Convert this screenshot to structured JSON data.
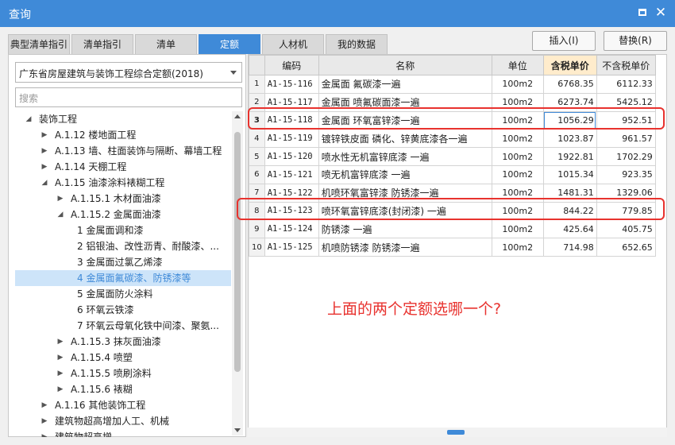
{
  "window": {
    "title": "查询"
  },
  "tabs": [
    "典型清单指引",
    "清单指引",
    "清单",
    "定额",
    "人材机",
    "我的数据"
  ],
  "actions": {
    "insert_label": "插入(I)",
    "replace_label": "替换(R)"
  },
  "left": {
    "quota_library": "广东省房屋建筑与装饰工程综合定额(2018)",
    "search_placeholder": "搜索",
    "tree": [
      {
        "label": "装饰工程",
        "level": 0,
        "toggle": "expanded"
      },
      {
        "label": "A.1.12 楼地面工程",
        "level": 1,
        "toggle": "collapsed"
      },
      {
        "label": "A.1.13 墙、柱面装饰与隔断、幕墙工程",
        "level": 1,
        "toggle": "collapsed"
      },
      {
        "label": "A.1.14 天棚工程",
        "level": 1,
        "toggle": "collapsed"
      },
      {
        "label": "A.1.15 油漆涂料裱糊工程",
        "level": 1,
        "toggle": "expanded"
      },
      {
        "label": "A.1.15.1 木材面油漆",
        "level": 2,
        "toggle": "collapsed"
      },
      {
        "label": "A.1.15.2 金属面油漆",
        "level": 2,
        "toggle": "expanded"
      },
      {
        "label": "1 金属面调和漆",
        "level": 3,
        "toggle": "none"
      },
      {
        "label": "2 铝银油、改性沥青、耐酸漆、...",
        "level": 3,
        "toggle": "none"
      },
      {
        "label": "3 金属面过氯乙烯漆",
        "level": 3,
        "toggle": "none"
      },
      {
        "label": "4 金属面氟碳漆、防锈漆等",
        "level": 3,
        "toggle": "none",
        "selected": true
      },
      {
        "label": "5 金属面防火涂料",
        "level": 3,
        "toggle": "none"
      },
      {
        "label": "6 环氧云铁漆",
        "level": 3,
        "toggle": "none"
      },
      {
        "label": "7 环氧云母氧化铁中间漆、聚氨...",
        "level": 3,
        "toggle": "none"
      },
      {
        "label": "A.1.15.3 抹灰面油漆",
        "level": 2,
        "toggle": "collapsed"
      },
      {
        "label": "A.1.15.4 喷塑",
        "level": 2,
        "toggle": "collapsed"
      },
      {
        "label": "A.1.15.5 喷刷涂料",
        "level": 2,
        "toggle": "collapsed"
      },
      {
        "label": "A.1.15.6 裱糊",
        "level": 2,
        "toggle": "collapsed"
      },
      {
        "label": "A.1.16 其他装饰工程",
        "level": 1,
        "toggle": "collapsed"
      },
      {
        "label": "建筑物超高增加人工、机械",
        "level": 1,
        "toggle": "collapsed"
      },
      {
        "label": "建筑物超高增...",
        "level": 1,
        "toggle": "collapsed"
      }
    ]
  },
  "grid": {
    "columns": [
      "",
      "编码",
      "名称",
      "单位",
      "含税单价",
      "不含税单价"
    ],
    "rows": [
      {
        "no": "1",
        "code": "A1-15-116",
        "name": "金属面 氟碳漆一遍",
        "unit": "100m2",
        "price_tax": "6768.35",
        "price_notax": "6112.33"
      },
      {
        "no": "2",
        "code": "A1-15-117",
        "name": "金属面 喷氟碳面漆一遍",
        "unit": "100m2",
        "price_tax": "6273.74",
        "price_notax": "5425.12"
      },
      {
        "no": "3",
        "code": "A1-15-118",
        "name": "金属面 环氧富锌漆一遍",
        "unit": "100m2",
        "price_tax": "1056.29",
        "price_notax": "952.51"
      },
      {
        "no": "4",
        "code": "A1-15-119",
        "name": "镀锌铁皮面 磷化、锌黄底漆各一遍",
        "unit": "100m2",
        "price_tax": "1023.87",
        "price_notax": "961.57"
      },
      {
        "no": "5",
        "code": "A1-15-120",
        "name": "喷水性无机富锌底漆 一遍",
        "unit": "100m2",
        "price_tax": "1922.81",
        "price_notax": "1702.29"
      },
      {
        "no": "6",
        "code": "A1-15-121",
        "name": "喷无机富锌底漆 一遍",
        "unit": "100m2",
        "price_tax": "1015.34",
        "price_notax": "923.35"
      },
      {
        "no": "7",
        "code": "A1-15-122",
        "name": "机喷环氧富锌漆 防锈漆一遍",
        "unit": "100m2",
        "price_tax": "1481.31",
        "price_notax": "1329.06"
      },
      {
        "no": "8",
        "code": "A1-15-123",
        "name": "喷环氧富锌底漆(封闭漆) 一遍",
        "unit": "100m2",
        "price_tax": "844.22",
        "price_notax": "779.85"
      },
      {
        "no": "9",
        "code": "A1-15-124",
        "name": "防锈漆 一遍",
        "unit": "100m2",
        "price_tax": "425.64",
        "price_notax": "405.75"
      },
      {
        "no": "10",
        "code": "A1-15-125",
        "name": "机喷防锈漆 防锈漆一遍",
        "unit": "100m2",
        "price_tax": "714.98",
        "price_notax": "652.65"
      }
    ]
  },
  "annotation": "上面的两个定额选哪一个?",
  "colors": {
    "accent": "#3f8ad8",
    "annotation": "#e8322e"
  },
  "icons": [
    "minimize-icon",
    "close-icon",
    "dropdown-arrow-icon",
    "tree-toggle-icon",
    "scroll-up-icon",
    "scroll-down-icon"
  ]
}
